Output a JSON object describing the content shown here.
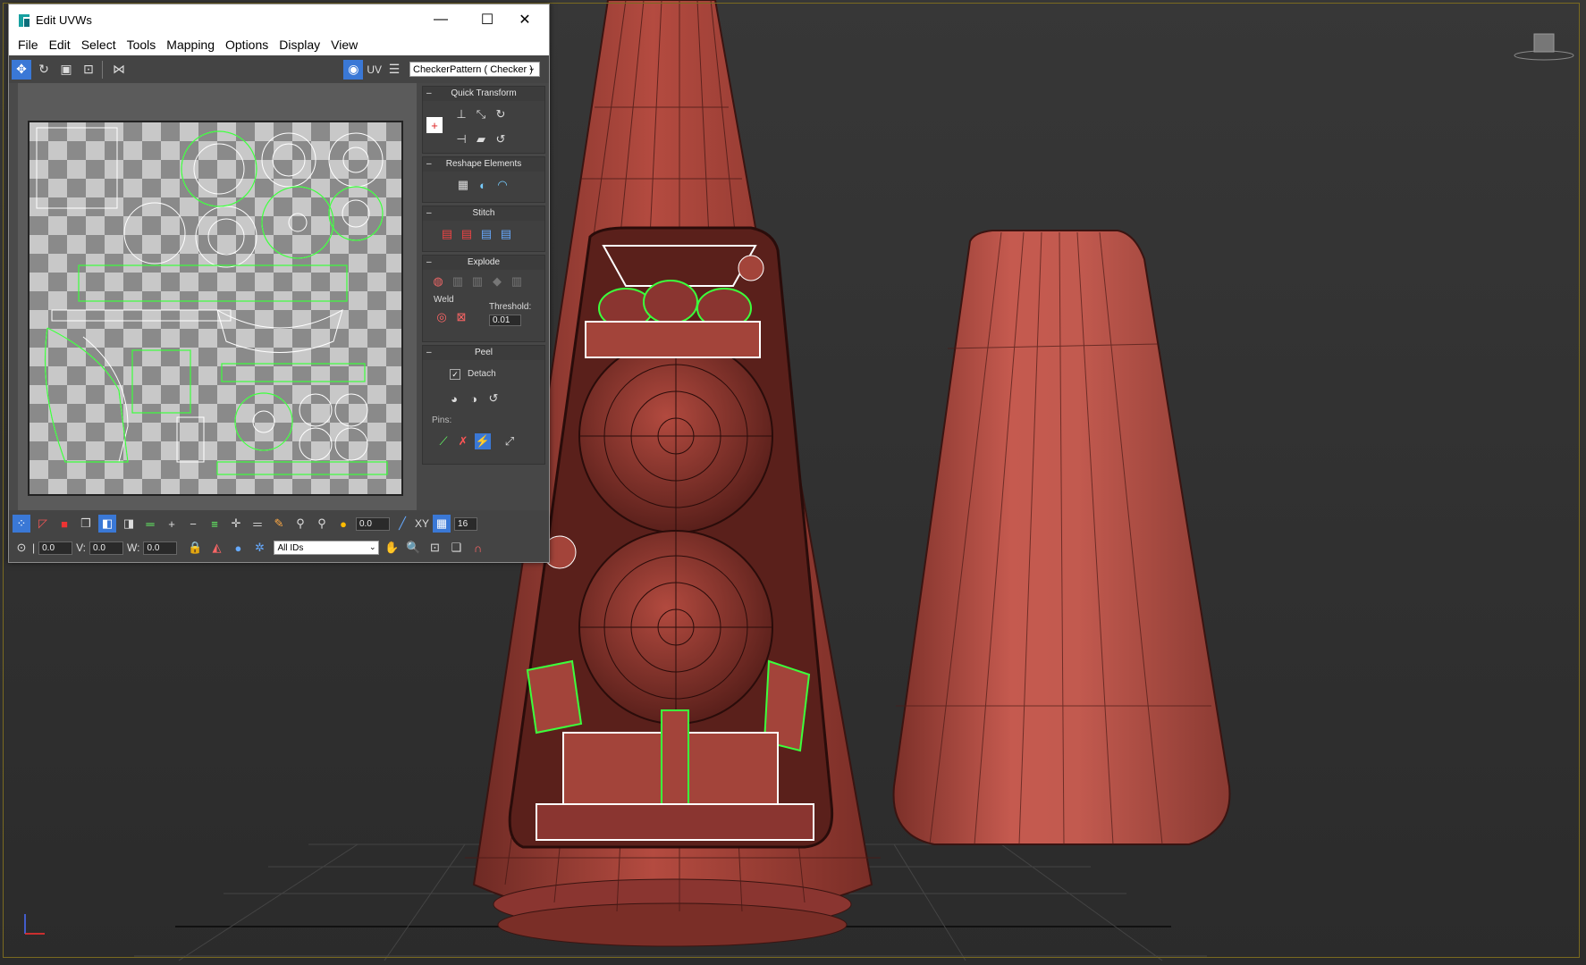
{
  "window": {
    "title": "Edit UVWs",
    "minimize": "—",
    "maximize": "☐",
    "close": "✕"
  },
  "menu": [
    "File",
    "Edit",
    "Select",
    "Tools",
    "Mapping",
    "Options",
    "Display",
    "View"
  ],
  "toolbar": {
    "uv_label": "UV",
    "texture_select": "CheckerPattern  ( Checker )"
  },
  "rollouts": {
    "quick_transform": "Quick Transform",
    "reshape_elements": "Reshape Elements",
    "stitch": "Stitch",
    "explode": "Explode",
    "weld_label": "Weld",
    "threshold_label": "Threshold:",
    "threshold_value": "0.01",
    "peel": "Peel",
    "detach_label": "Detach",
    "detach_checked": true,
    "pins_label": "Pins:"
  },
  "bottombar": {
    "rotate_value": "0.0",
    "grid_value": "16",
    "xy_label": "XY",
    "u_value": "0.0",
    "v_label": "V:",
    "v_value": "0.0",
    "w_label": "W:",
    "w_value": "0.0",
    "ids_select": "All IDs"
  },
  "colors": {
    "accent": "#3a78d6",
    "mesh_red": "#a3443a",
    "wire": "#4a1a16",
    "selection_green": "#3cff3c",
    "viewport_bg": "#303030"
  }
}
